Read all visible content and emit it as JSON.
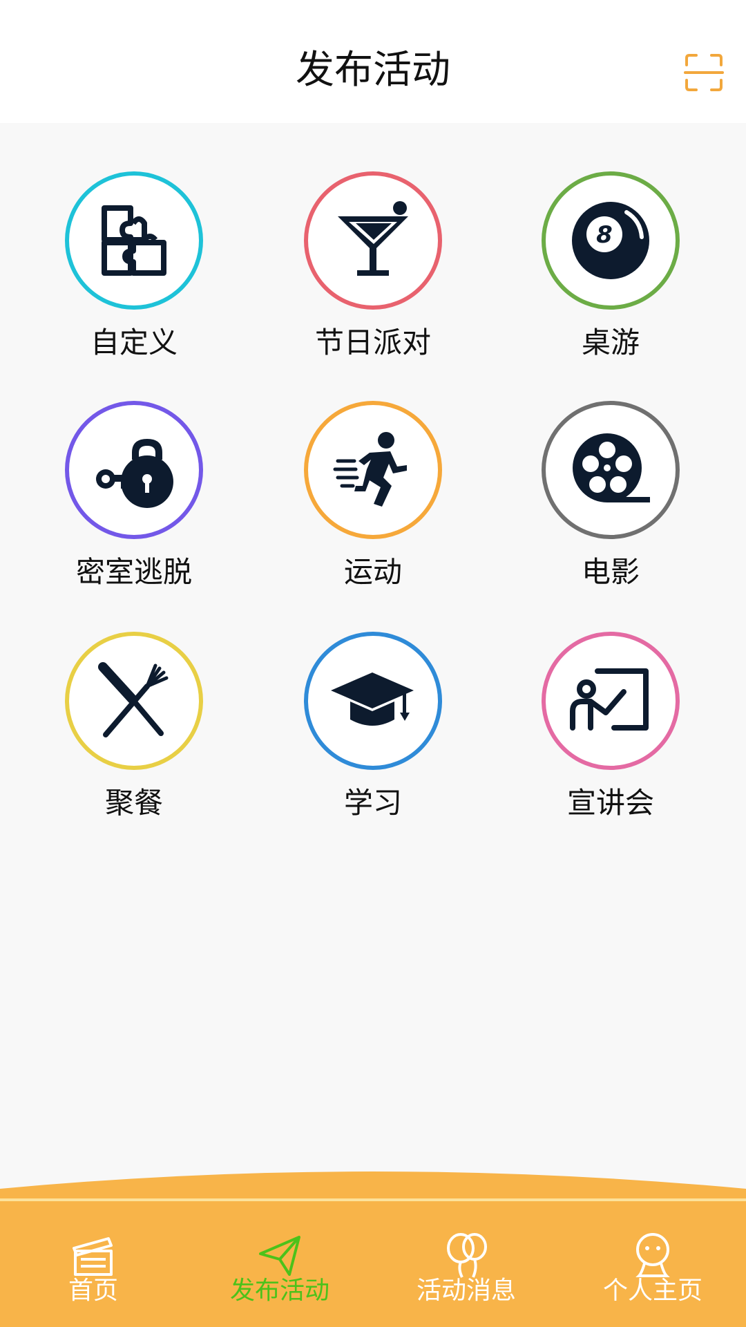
{
  "header": {
    "title": "发布活动"
  },
  "colors": {
    "accent_orange": "#f8b449",
    "active_green": "#4cc21a",
    "icon_dark": "#0d1b2e"
  },
  "categories": [
    {
      "label": "自定义",
      "icon": "puzzle-icon",
      "ring_color": "#1ec2d8"
    },
    {
      "label": "节日派对",
      "icon": "cocktail-icon",
      "ring_color": "#e8626e"
    },
    {
      "label": "桌游",
      "icon": "billiard-ball-icon",
      "ring_color": "#6cac46"
    },
    {
      "label": "密室逃脱",
      "icon": "lock-key-icon",
      "ring_color": "#7358e8"
    },
    {
      "label": "运动",
      "icon": "runner-icon",
      "ring_color": "#f6a83a"
    },
    {
      "label": "电影",
      "icon": "film-reel-icon",
      "ring_color": "#707070"
    },
    {
      "label": "聚餐",
      "icon": "knife-fork-icon",
      "ring_color": "#e8cf45"
    },
    {
      "label": "学习",
      "icon": "graduation-cap-icon",
      "ring_color": "#2f8bd8"
    },
    {
      "label": "宣讲会",
      "icon": "presentation-icon",
      "ring_color": "#e46aa3"
    }
  ],
  "tabs": [
    {
      "label": "首页",
      "icon": "clapperboard-icon",
      "active": false
    },
    {
      "label": "发布活动",
      "icon": "paper-plane-icon",
      "active": true
    },
    {
      "label": "活动消息",
      "icon": "balloons-icon",
      "active": false
    },
    {
      "label": "个人主页",
      "icon": "person-icon",
      "active": false
    }
  ]
}
